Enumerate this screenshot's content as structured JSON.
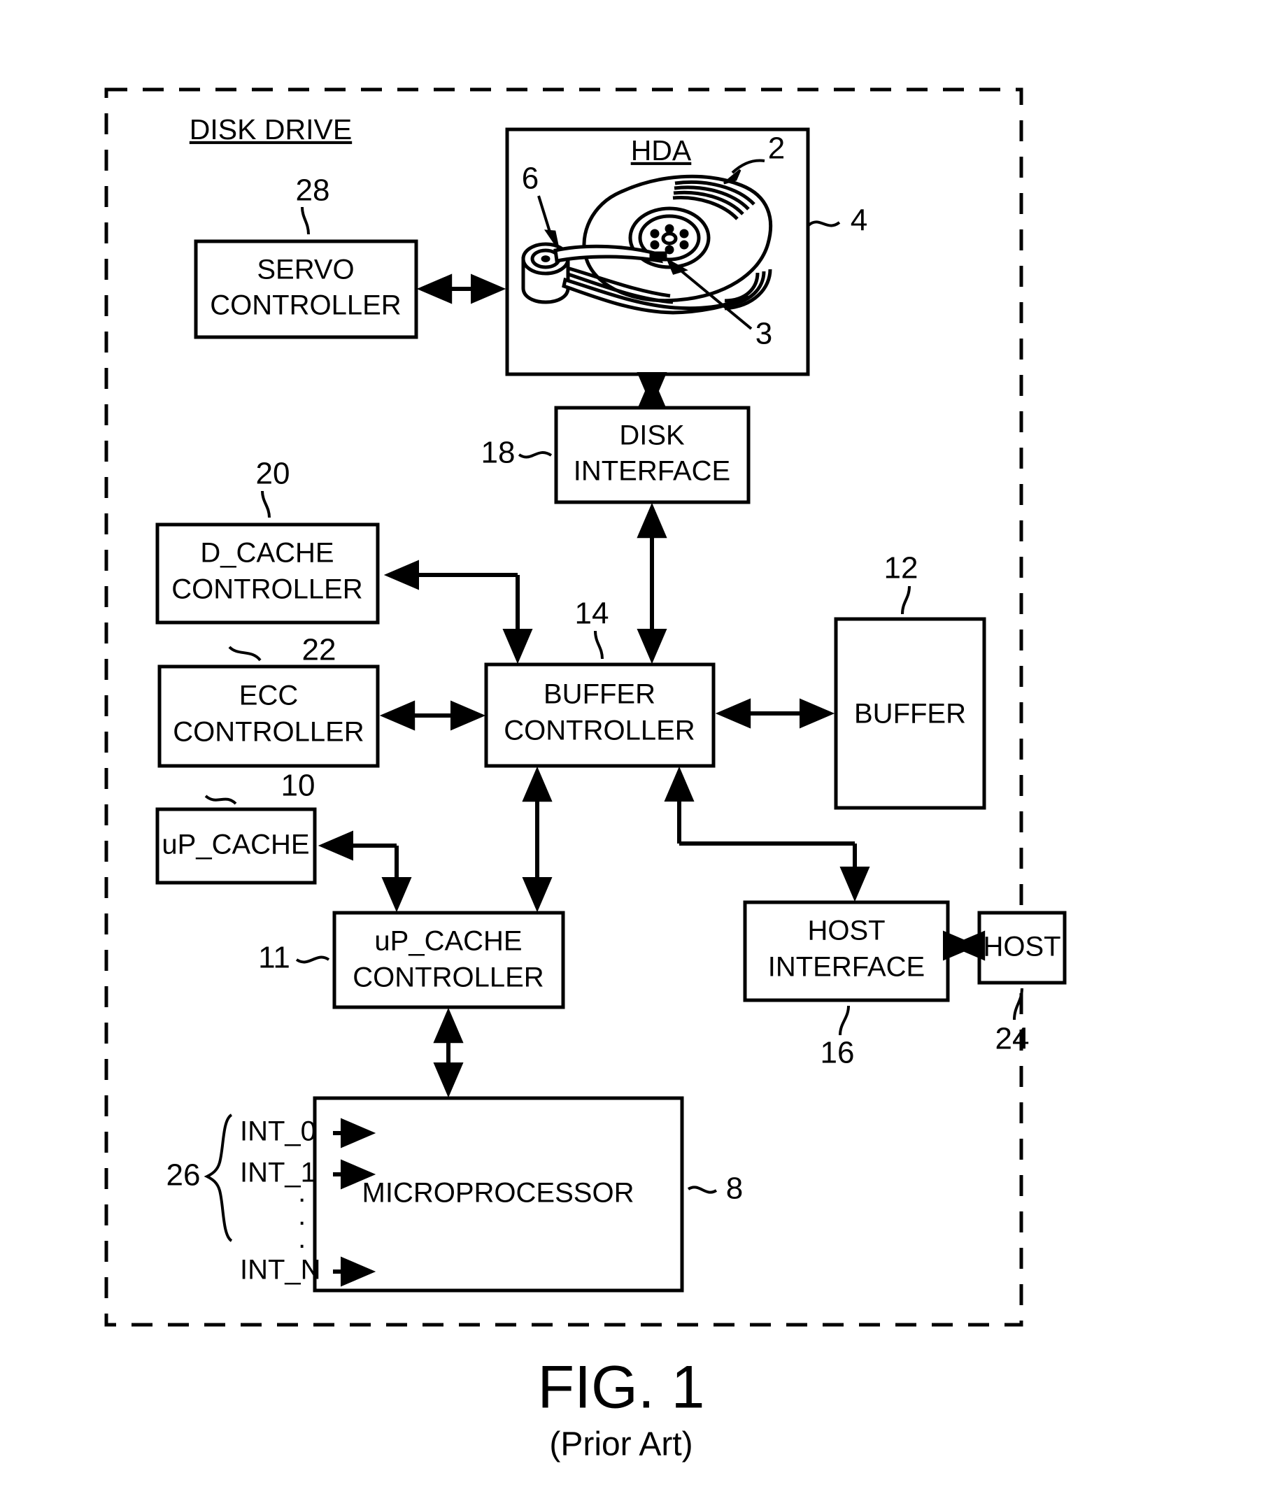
{
  "figure": {
    "caption": "FIG. 1",
    "subcaption": "(Prior Art)",
    "enclosure_title": "DISK DRIVE"
  },
  "blocks": {
    "servo_controller": {
      "line1": "SERVO",
      "line2": "CONTROLLER",
      "ref": "28"
    },
    "hda": {
      "title": "HDA",
      "ref_disk": "2",
      "ref_head": "3",
      "ref_actuator": "6",
      "ref_hda": "4"
    },
    "disk_interface": {
      "line1": "DISK",
      "line2": "INTERFACE",
      "ref": "18"
    },
    "d_cache_controller": {
      "line1": "D_CACHE",
      "line2": "CONTROLLER",
      "ref": "20"
    },
    "ecc_controller": {
      "line1": "ECC",
      "line2": "CONTROLLER",
      "ref": "22"
    },
    "buffer_controller": {
      "line1": "BUFFER",
      "line2": "CONTROLLER",
      "ref": "14"
    },
    "buffer": {
      "line1": "BUFFER",
      "ref": "12"
    },
    "up_cache": {
      "line1": "uP_CACHE",
      "ref": "10"
    },
    "up_cache_controller": {
      "line1": "uP_CACHE",
      "line2": "CONTROLLER",
      "ref": "11"
    },
    "microprocessor": {
      "line1": "MICROPROCESSOR",
      "ref": "8"
    },
    "host_interface": {
      "line1": "HOST",
      "line2": "INTERFACE",
      "ref": "16"
    },
    "host": {
      "line1": "HOST",
      "ref": "24"
    }
  },
  "interrupts": {
    "ref": "26",
    "labels": [
      "INT_0",
      "INT_1",
      "INT_N"
    ],
    "ellipsis": "·"
  },
  "colors": {
    "ink": "#000000",
    "paper": "#ffffff"
  }
}
